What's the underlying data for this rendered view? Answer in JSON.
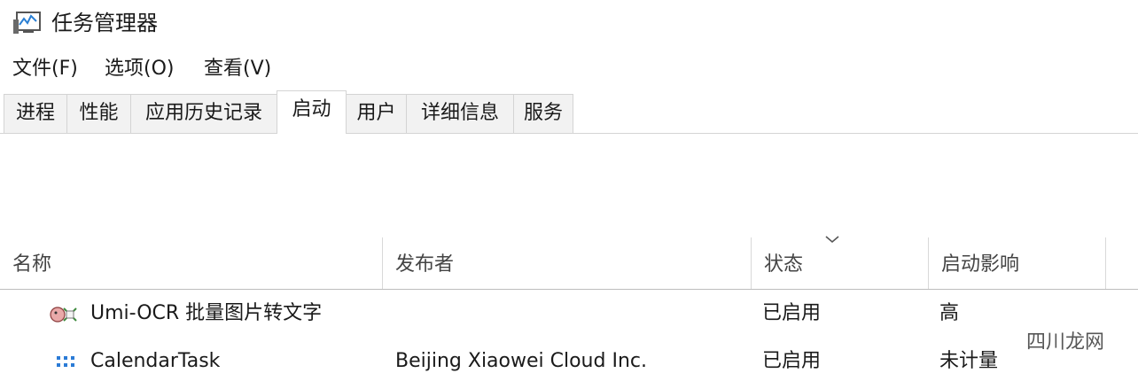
{
  "window": {
    "title": "任务管理器",
    "app_icon": "task-manager-icon"
  },
  "menu": [
    {
      "label": "文件(F)"
    },
    {
      "label": "选项(O)"
    },
    {
      "label": "查看(V)"
    }
  ],
  "tabs": [
    {
      "label": "进程",
      "active": false
    },
    {
      "label": "性能",
      "active": false
    },
    {
      "label": "应用历史记录",
      "active": false
    },
    {
      "label": "启动",
      "active": true
    },
    {
      "label": "用户",
      "active": false
    },
    {
      "label": "详细信息",
      "active": false
    },
    {
      "label": "服务",
      "active": false
    }
  ],
  "table": {
    "columns": [
      {
        "label": "名称"
      },
      {
        "label": "发布者"
      },
      {
        "label": "状态",
        "sorted": "descending"
      },
      {
        "label": "启动影响"
      }
    ],
    "rows": [
      {
        "icon": "umi-ocr-icon",
        "name": "Umi-OCR 批量图片转文字",
        "publisher": "",
        "status": "已启用",
        "impact": "高"
      },
      {
        "icon": "calendar-task-icon",
        "name": "CalendarTask",
        "publisher": "Beijing Xiaowei Cloud Inc.",
        "status": "已启用",
        "impact": "未计量"
      }
    ]
  },
  "watermark": {
    "text": "四川龙网"
  }
}
